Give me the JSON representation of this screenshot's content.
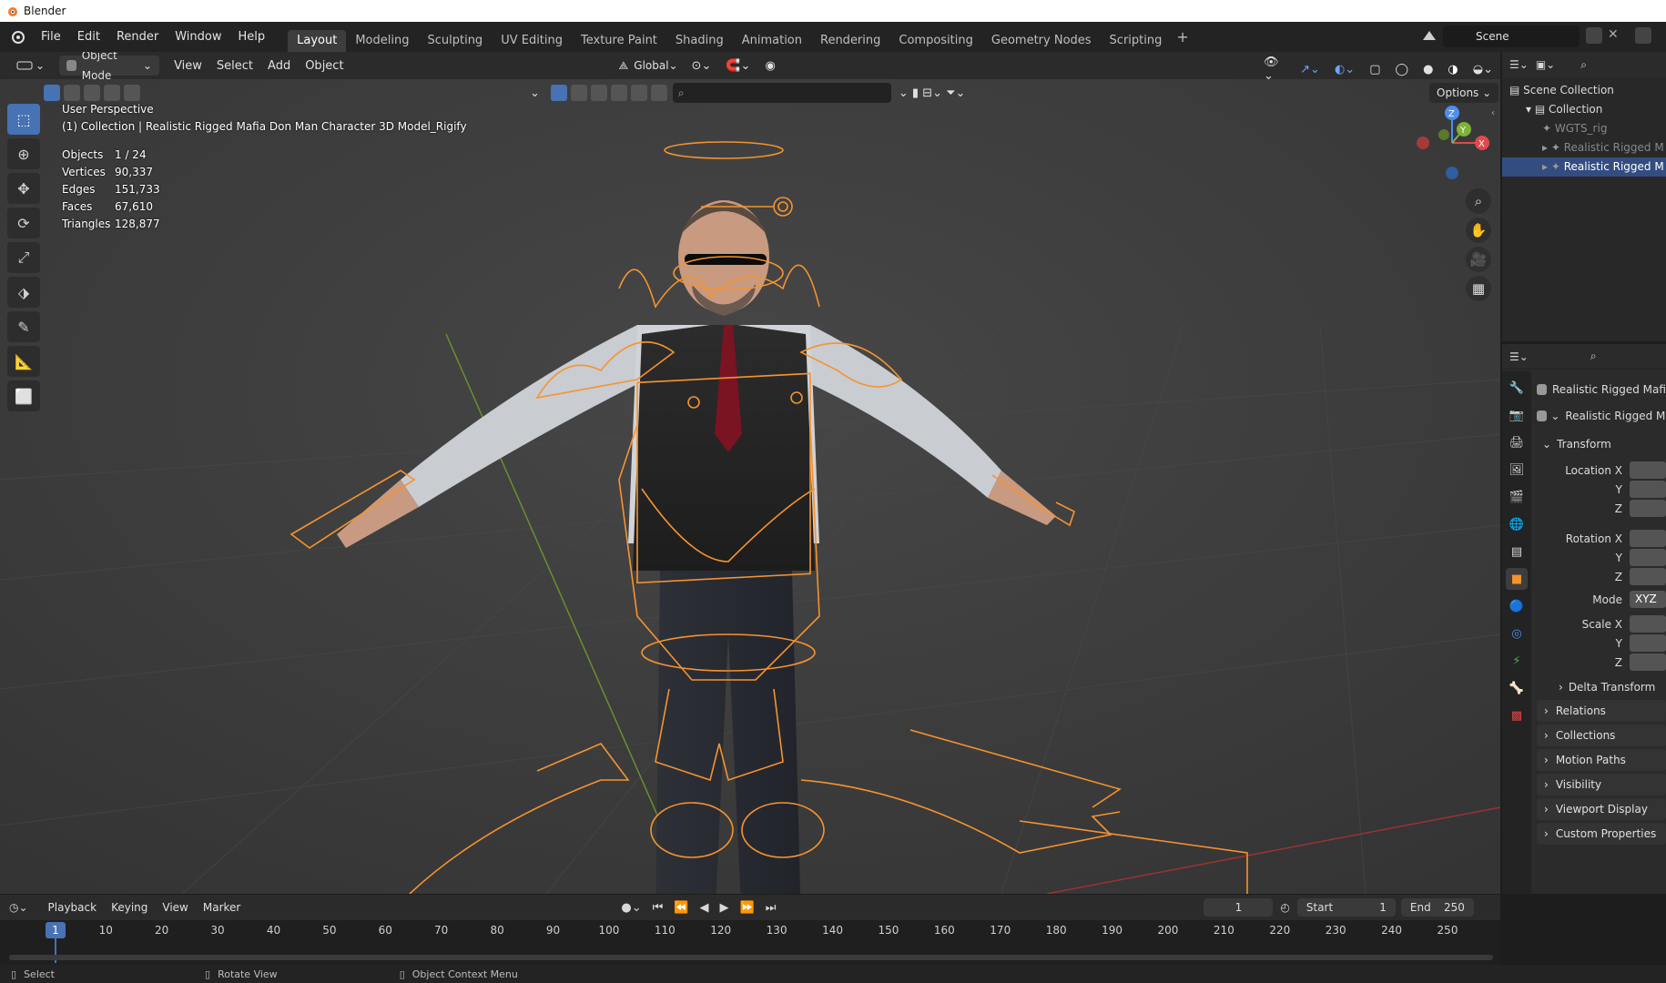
{
  "app": {
    "title": "Blender"
  },
  "menu": [
    "File",
    "Edit",
    "Render",
    "Window",
    "Help"
  ],
  "workspaces": [
    {
      "label": "Layout",
      "active": true
    },
    {
      "label": "Modeling"
    },
    {
      "label": "Sculpting"
    },
    {
      "label": "UV Editing"
    },
    {
      "label": "Texture Paint"
    },
    {
      "label": "Shading"
    },
    {
      "label": "Animation"
    },
    {
      "label": "Rendering"
    },
    {
      "label": "Compositing"
    },
    {
      "label": "Geometry Nodes"
    },
    {
      "label": "Scripting"
    }
  ],
  "add_workspace": "+",
  "scene": {
    "name": "Scene"
  },
  "viewport_header": {
    "mode": "Object Mode",
    "menus": [
      "View",
      "Select",
      "Add",
      "Object"
    ],
    "orientation": "Global",
    "options": "Options"
  },
  "overlay": {
    "perspective": "User Perspective",
    "collection": "(1) Collection | Realistic Rigged Mafia Don Man Character 3D Model_Rigify",
    "stats": [
      {
        "k": "Objects",
        "v": "1 / 24"
      },
      {
        "k": "Vertices",
        "v": "90,337"
      },
      {
        "k": "Edges",
        "v": "151,733"
      },
      {
        "k": "Faces",
        "v": "67,610"
      },
      {
        "k": "Triangles",
        "v": "128,877"
      }
    ]
  },
  "gizmo": {
    "z": "Z",
    "y": "Y",
    "x": "X"
  },
  "outliner": {
    "rows": [
      {
        "label": "Scene Collection",
        "indent": 0
      },
      {
        "label": "Collection",
        "indent": 1
      },
      {
        "label": "WGTS_rig",
        "indent": 2
      },
      {
        "label": "Realistic Rigged M",
        "indent": 2
      },
      {
        "label": "Realistic Rigged M",
        "indent": 2,
        "selected": true
      }
    ]
  },
  "properties": {
    "object_name": "Realistic Rigged Mafi...",
    "data_name": "Realistic Rigged Ma",
    "transform": "Transform",
    "location": [
      "Location X",
      "Y",
      "Z"
    ],
    "rotation": [
      "Rotation X",
      "Y",
      "Z"
    ],
    "mode_label": "Mode",
    "mode_value": "XYZ",
    "scale": [
      "Scale X",
      "Y",
      "Z"
    ],
    "delta": "Delta Transform",
    "panels": [
      "Relations",
      "Collections",
      "Motion Paths",
      "Visibility",
      "Viewport Display",
      "Custom Properties"
    ]
  },
  "timeline": {
    "menus": [
      "Playback",
      "Keying",
      "View",
      "Marker"
    ],
    "current_frame": "1",
    "start_label": "Start",
    "start": "1",
    "end_label": "End",
    "end": "250",
    "ticks": [
      "1",
      "10",
      "20",
      "30",
      "40",
      "50",
      "60",
      "70",
      "80",
      "90",
      "100",
      "110",
      "120",
      "130",
      "140",
      "150",
      "160",
      "170",
      "180",
      "190",
      "200",
      "210",
      "220",
      "230",
      "240",
      "250"
    ]
  },
  "status": {
    "select": "Select",
    "rotate": "Rotate View",
    "context": "Object Context Menu"
  },
  "colors": {
    "accent": "#4772b3",
    "selection": "#f5932f",
    "bg": "#3d3d3d"
  }
}
